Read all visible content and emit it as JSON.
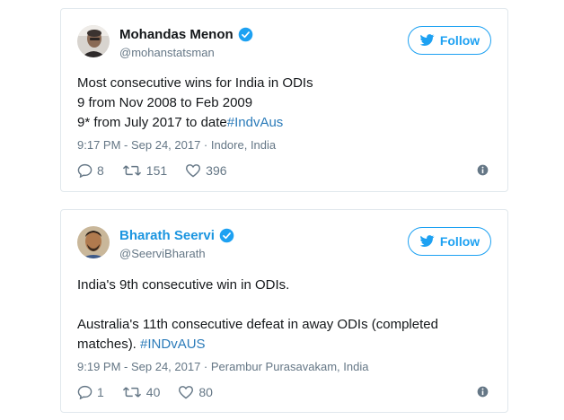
{
  "tweets": [
    {
      "author": {
        "name": "Mohandas Menon",
        "handle": "@mohanstatsman",
        "verified": true
      },
      "follow_label": "Follow",
      "lines": [
        "Most consecutive wins for India in ODIs",
        "9 from Nov 2008 to Feb 2009"
      ],
      "line3_text": "9* from July 2017 to date",
      "line3_hashtag": "#IndvAus",
      "meta": "9:17 PM - Sep 24, 2017 · Indore, India",
      "replies": "8",
      "retweets": "151",
      "likes": "396"
    },
    {
      "author": {
        "name": "Bharath Seervi",
        "handle": "@SeerviBharath",
        "verified": true
      },
      "follow_label": "Follow",
      "line1": "India's 9th consecutive win in ODIs.",
      "line2": "Australia's 11th consecutive defeat in away ODIs (completed",
      "line3_text": "matches). ",
      "line3_hashtag": "#INDvAUS",
      "meta": "9:19 PM - Sep 24, 2017 · Perambur Purasavakam, India",
      "replies": "1",
      "retweets": "40",
      "likes": "80"
    }
  ],
  "colors": {
    "twitter_blue": "#1da1f2",
    "link_blue": "#2b7bb9",
    "gray": "#657786",
    "border": "#e1e8ed"
  },
  "icons": [
    "verified-badge-icon",
    "twitter-bird-icon",
    "reply-icon",
    "retweet-icon",
    "like-heart-icon",
    "info-icon"
  ]
}
